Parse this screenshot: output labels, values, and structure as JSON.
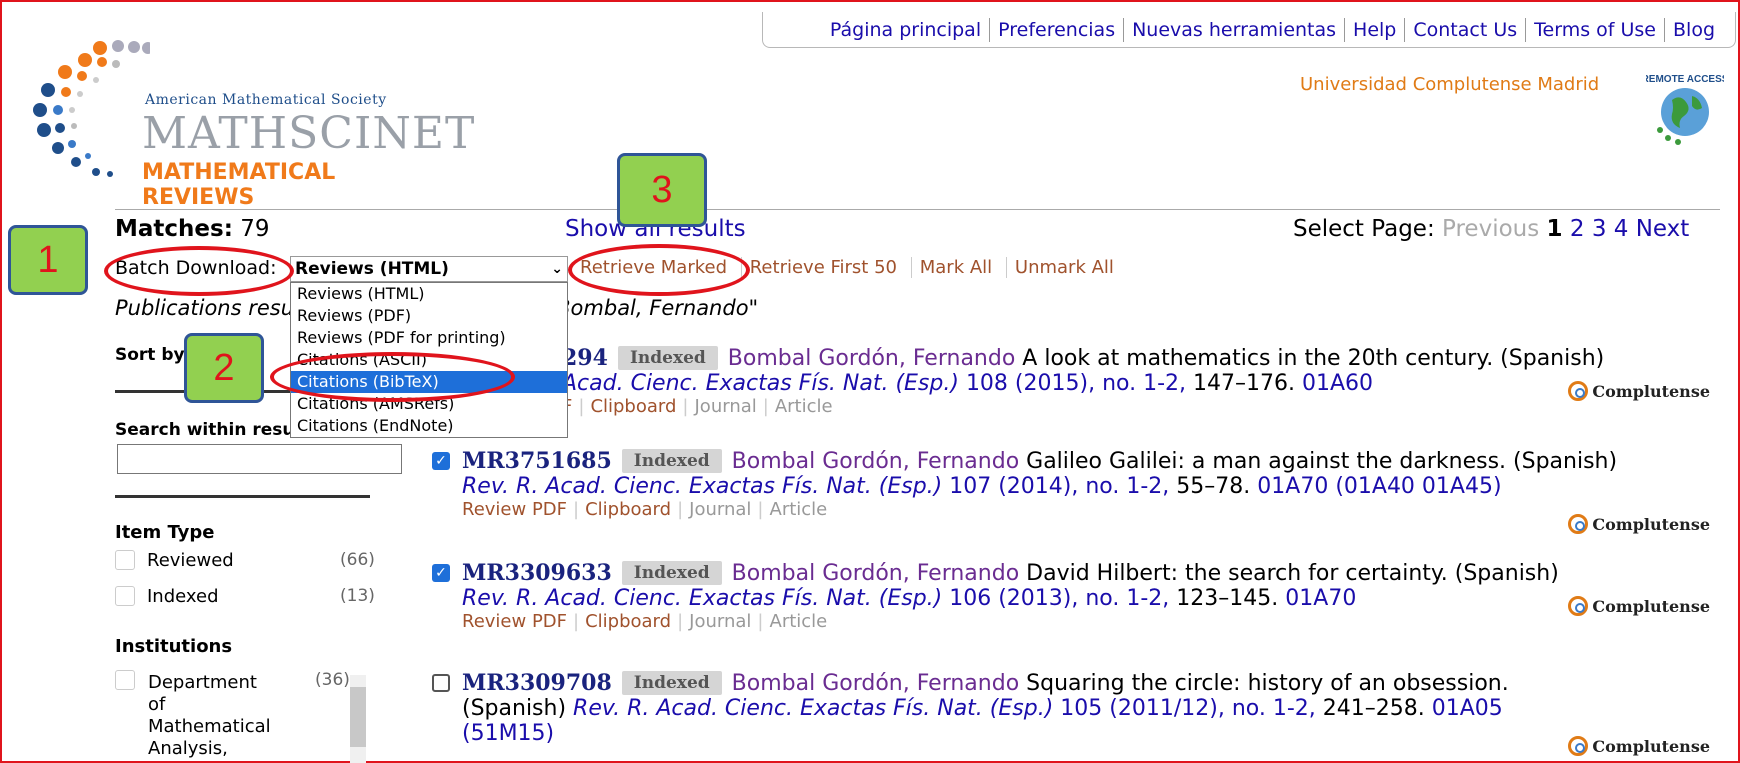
{
  "topnav": [
    "Página principal",
    "Preferencias",
    "Nuevas herramientas",
    "Help",
    "Contact Us",
    "Terms of Use",
    "Blog"
  ],
  "logo": {
    "line1": "American Mathematical Society",
    "line2": "MATHSCINET",
    "line3": "MATHEMATICAL REVIEWS"
  },
  "institution": "Universidad Complutense Madrid",
  "remote_access": "REMOTE ACCESS",
  "matches_label": "Matches:",
  "matches_count": "79",
  "show_all": "Show all results",
  "select_page": {
    "label": "Select Page:",
    "prev": "Previous",
    "current": "1",
    "pages": [
      "2",
      "3",
      "4"
    ],
    "next": "Next"
  },
  "batch": {
    "label": "Batch Download:",
    "selected": "Reviews (HTML)",
    "options": [
      "Reviews (HTML)",
      "Reviews (PDF)",
      "Reviews (PDF for printing)",
      "Citations (ASCII)",
      "Citations (BibTeX)",
      "Citations (AMSRefs)",
      "Citations (EndNote)"
    ],
    "actions": [
      "Retrieve Marked",
      "Retrieve First 50",
      "Mark All",
      "Unmark All"
    ]
  },
  "publications_prefix": "Publications resu",
  "publications_suffix": "y Bombal, Fernando\"",
  "sort_by": "Sort by",
  "search_within": "Search within resu",
  "item_type": {
    "title": "Item Type",
    "items": [
      {
        "label": "Reviewed",
        "count": "(66)"
      },
      {
        "label": "Indexed",
        "count": "(13)"
      }
    ]
  },
  "institutions": {
    "title": "Institutions",
    "item": {
      "label": "Department of Mathematical Analysis,",
      "count": "(36)"
    }
  },
  "results": [
    {
      "mr": "294",
      "badge": "Indexed",
      "author": "Bombal Gordón, Fernando",
      "title": "A look at mathematics in the 20th century. (Spanish)",
      "journal": "Acad. Cienc. Exactas Fís. Nat. (Esp.)",
      "vol": "108 (2015), no. 1-2,",
      "pages": "147–176.",
      "cls": "01A60",
      "links": [
        "F",
        "Clipboard",
        "Journal",
        "Article"
      ],
      "checked": true
    },
    {
      "mr": "MR3751685",
      "badge": "Indexed",
      "author": "Bombal Gordón, Fernando",
      "title": "Galileo Galilei: a man against the darkness. (Spanish)",
      "journal": "Rev. R. Acad. Cienc. Exactas Fís. Nat. (Esp.)",
      "vol": "107 (2014), no. 1-2,",
      "pages": "55–78.",
      "cls": "01A70 (01A40 01A45)",
      "links": [
        "Review PDF",
        "Clipboard",
        "Journal",
        "Article"
      ],
      "checked": true
    },
    {
      "mr": "MR3309633",
      "badge": "Indexed",
      "author": "Bombal Gordón, Fernando",
      "title": "David Hilbert: the search for certainty. (Spanish)",
      "journal": "Rev. R. Acad. Cienc. Exactas Fís. Nat. (Esp.)",
      "vol": "106 (2013), no. 1-2,",
      "pages": "123–145.",
      "cls": "01A70",
      "links": [
        "Review PDF",
        "Clipboard",
        "Journal",
        "Article"
      ],
      "checked": true
    },
    {
      "mr": "MR3309708",
      "badge": "Indexed",
      "author": "Bombal Gordón, Fernando",
      "title": "Squaring the circle: history of an obsession.",
      "line2_prefix": "(Spanish)",
      "journal": "Rev. R. Acad. Cienc. Exactas Fís. Nat. (Esp.)",
      "vol": "105 (2011/12), no. 1-2,",
      "pages": "241–258.",
      "cls": "01A05",
      "cls2": "(51M15)",
      "checked": false
    }
  ],
  "complutense": "Complutense",
  "annotations": [
    "1",
    "2",
    "3"
  ],
  "colors": {
    "frame": "#e0141c",
    "annotation_bg": "#92d050",
    "annotation_border": "#2f5597",
    "link": "#1a0dab",
    "author": "#6a2c91",
    "institution": "#e07b16"
  }
}
